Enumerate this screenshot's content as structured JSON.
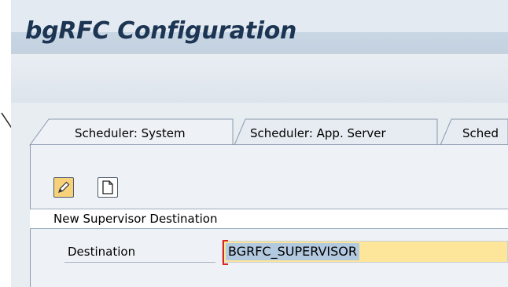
{
  "window": {
    "title": "bgRFC Configuration"
  },
  "tabs": [
    {
      "label": "Scheduler: System",
      "active": true
    },
    {
      "label": "Scheduler: App. Server",
      "active": false
    },
    {
      "label": "Sched",
      "active": false
    }
  ],
  "toolbar": {
    "edit_icon": "pencil-icon",
    "new_icon": "new-document-icon"
  },
  "group": {
    "title": "New Supervisor Destination"
  },
  "destination": {
    "label": "Destination",
    "value": "BGRFC_SUPERVISOR"
  },
  "colors": {
    "title": "#1c3553",
    "input_bg": "#fde69a",
    "selection": "#b3c9df",
    "edit_button": "#f7d27a"
  }
}
